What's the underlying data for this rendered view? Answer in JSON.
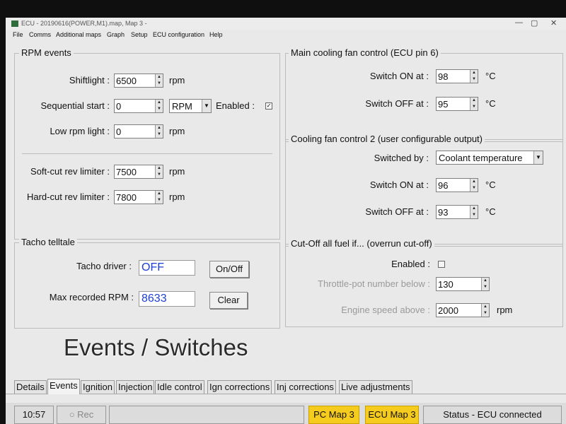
{
  "window": {
    "title": "ECU - 20190616(POWER,M1).map,  Map 3 -",
    "controls": [
      "—",
      "▢",
      "✕"
    ]
  },
  "menu": [
    "File",
    "Comms",
    "Additional maps",
    "Graph",
    "Setup",
    "ECU configuration",
    "Help"
  ],
  "rpm_events": {
    "legend": "RPM events",
    "shiftlight_label": "Shiftlight :",
    "shiftlight_value": "6500",
    "seq_start_label": "Sequential start :",
    "seq_start_value": "0",
    "seq_unit_selected": "RPM",
    "enabled_label": "Enabled :",
    "low_rpm_label": "Low rpm light :",
    "low_rpm_value": "0",
    "soft_cut_label": "Soft-cut rev limiter :",
    "soft_cut_value": "7500",
    "hard_cut_label": "Hard-cut rev limiter :",
    "hard_cut_value": "7800",
    "unit": "rpm"
  },
  "tacho": {
    "legend": "Tacho telltale",
    "driver_label": "Tacho driver :",
    "driver_value": "OFF",
    "onoff_button": "On/Off",
    "max_rpm_label": "Max recorded RPM :",
    "max_rpm_value": "8633",
    "clear_button": "Clear"
  },
  "main_fan": {
    "legend": "Main cooling fan control (ECU pin 6)",
    "on_label": "Switch ON at :",
    "on_value": "98",
    "off_label": "Switch OFF at :",
    "off_value": "95",
    "unit": "°C"
  },
  "fan2": {
    "legend": "Cooling fan control 2 (user configurable output)",
    "switched_by_label": "Switched by :",
    "switched_by_value": "Coolant temperature",
    "on_label": "Switch ON at :",
    "on_value": "96",
    "off_label": "Switch OFF at :",
    "off_value": "93",
    "unit": "°C"
  },
  "cutoff": {
    "legend": "Cut-Off all fuel if...   (overrun cut-off)",
    "enabled_label": "Enabled :",
    "throttle_label": "Throttle-pot number below :",
    "throttle_value": "130",
    "speed_label": "Engine speed above :",
    "speed_value": "2000",
    "unit": "rpm"
  },
  "page_title": "Events / Switches",
  "tabs": [
    "Details",
    "Events",
    "Ignition",
    "Injection",
    "Idle control",
    "Ign corrections",
    "Inj corrections",
    "Live adjustments"
  ],
  "status": {
    "time": "10:57",
    "rec": "Rec",
    "pc_map": "PC Map 3",
    "ecu_map": "ECU Map 3",
    "status_text": "Status - ECU connected",
    "highlight_color": "#f5cb1e"
  }
}
